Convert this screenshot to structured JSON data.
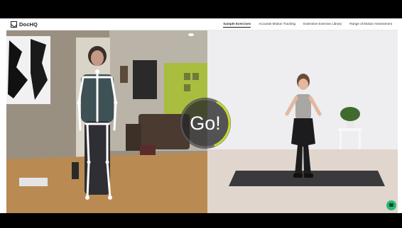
{
  "app": {
    "logo_text": "DocHQ"
  },
  "navigation": {
    "links": [
      {
        "label": "Sample Exercises",
        "active": true
      },
      {
        "label": "Accurate Motion Tracking",
        "active": false
      },
      {
        "label": "Extensive Exercise Library",
        "active": false
      },
      {
        "label": "Range of Motion Assessment",
        "active": false
      }
    ]
  },
  "countdown": {
    "text": "Go!",
    "progress": 0.35,
    "ring_color": "#c8d92a"
  },
  "colors": {
    "skeleton": "#ffffff",
    "chat_button": "#2bb673"
  },
  "icons": {
    "logo": "dochq-logo-icon",
    "chat": "chat-bubble-icon"
  }
}
